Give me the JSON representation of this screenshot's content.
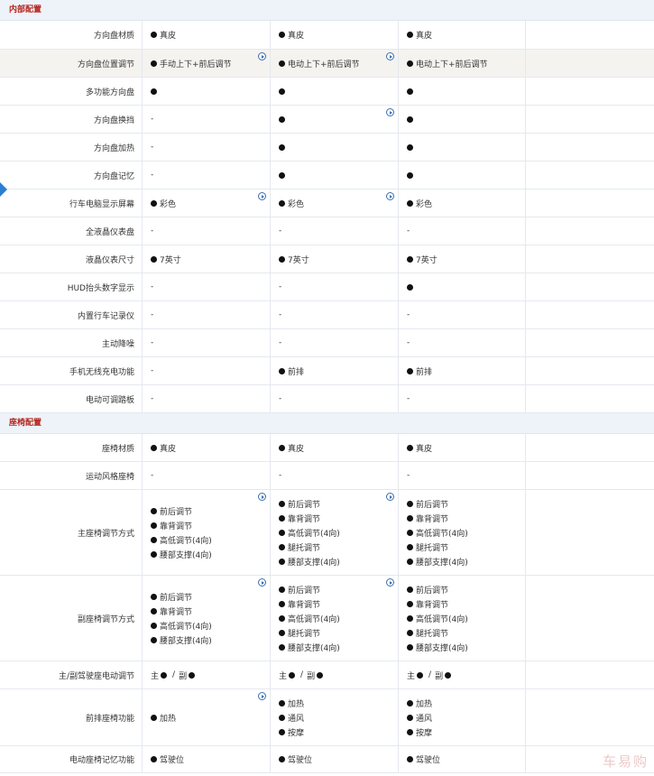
{
  "sections": [
    {
      "title": "内部配置",
      "rows": [
        {
          "label": "方向盘材质",
          "cells": [
            {
              "type": "lines",
              "lines": [
                {
                  "dot": true,
                  "text": "真皮"
                }
              ]
            },
            {
              "type": "lines",
              "lines": [
                {
                  "dot": true,
                  "text": "真皮"
                }
              ]
            },
            {
              "type": "lines",
              "lines": [
                {
                  "dot": true,
                  "text": "真皮"
                }
              ]
            }
          ],
          "h": 32
        },
        {
          "label": "方向盘位置调节",
          "hl": true,
          "cells": [
            {
              "type": "lines",
              "play": true,
              "lines": [
                {
                  "dot": true,
                  "text": "手动上下+前后调节"
                }
              ]
            },
            {
              "type": "lines",
              "play": true,
              "lines": [
                {
                  "dot": true,
                  "text": "电动上下+前后调节"
                }
              ]
            },
            {
              "type": "lines",
              "lines": [
                {
                  "dot": true,
                  "text": "电动上下+前后调节"
                }
              ]
            }
          ],
          "h": 31
        },
        {
          "label": "多功能方向盘",
          "cells": [
            {
              "type": "lines",
              "lines": [
                {
                  "dot": true,
                  "text": ""
                }
              ]
            },
            {
              "type": "lines",
              "lines": [
                {
                  "dot": true,
                  "text": ""
                }
              ]
            },
            {
              "type": "lines",
              "lines": [
                {
                  "dot": true,
                  "text": ""
                }
              ]
            }
          ],
          "h": 31
        },
        {
          "label": "方向盘换挡",
          "cells": [
            {
              "type": "lines",
              "lines": [
                {
                  "dot": false,
                  "text": "-"
                }
              ]
            },
            {
              "type": "lines",
              "play": true,
              "lines": [
                {
                  "dot": true,
                  "text": ""
                }
              ]
            },
            {
              "type": "lines",
              "lines": [
                {
                  "dot": true,
                  "text": ""
                }
              ]
            }
          ],
          "h": 31
        },
        {
          "label": "方向盘加热",
          "cells": [
            {
              "type": "lines",
              "lines": [
                {
                  "dot": false,
                  "text": "-"
                }
              ]
            },
            {
              "type": "lines",
              "lines": [
                {
                  "dot": true,
                  "text": ""
                }
              ]
            },
            {
              "type": "lines",
              "lines": [
                {
                  "dot": true,
                  "text": ""
                }
              ]
            }
          ],
          "h": 31
        },
        {
          "label": "方向盘记忆",
          "cells": [
            {
              "type": "lines",
              "lines": [
                {
                  "dot": false,
                  "text": "-"
                }
              ]
            },
            {
              "type": "lines",
              "lines": [
                {
                  "dot": true,
                  "text": ""
                }
              ]
            },
            {
              "type": "lines",
              "lines": [
                {
                  "dot": true,
                  "text": ""
                }
              ]
            }
          ],
          "h": 31
        },
        {
          "label": "行车电脑显示屏幕",
          "cells": [
            {
              "type": "lines",
              "play": true,
              "lines": [
                {
                  "dot": true,
                  "text": "彩色"
                }
              ]
            },
            {
              "type": "lines",
              "play": true,
              "lines": [
                {
                  "dot": true,
                  "text": "彩色"
                }
              ]
            },
            {
              "type": "lines",
              "lines": [
                {
                  "dot": true,
                  "text": "彩色"
                }
              ]
            }
          ],
          "h": 31
        },
        {
          "label": "全液晶仪表盘",
          "cells": [
            {
              "type": "lines",
              "lines": [
                {
                  "dot": false,
                  "text": "-"
                }
              ]
            },
            {
              "type": "lines",
              "lines": [
                {
                  "dot": false,
                  "text": "-"
                }
              ]
            },
            {
              "type": "lines",
              "lines": [
                {
                  "dot": false,
                  "text": "-"
                }
              ]
            }
          ],
          "h": 31
        },
        {
          "label": "液晶仪表尺寸",
          "cells": [
            {
              "type": "lines",
              "lines": [
                {
                  "dot": true,
                  "text": "7英寸"
                }
              ]
            },
            {
              "type": "lines",
              "lines": [
                {
                  "dot": true,
                  "text": "7英寸"
                }
              ]
            },
            {
              "type": "lines",
              "lines": [
                {
                  "dot": true,
                  "text": "7英寸"
                }
              ]
            }
          ],
          "h": 31
        },
        {
          "label": "HUD抬头数字显示",
          "cells": [
            {
              "type": "lines",
              "lines": [
                {
                  "dot": false,
                  "text": "-"
                }
              ]
            },
            {
              "type": "lines",
              "lines": [
                {
                  "dot": false,
                  "text": "-"
                }
              ]
            },
            {
              "type": "lines",
              "lines": [
                {
                  "dot": true,
                  "text": ""
                }
              ]
            }
          ],
          "h": 31
        },
        {
          "label": "内置行车记录仪",
          "cells": [
            {
              "type": "lines",
              "lines": [
                {
                  "dot": false,
                  "text": "-"
                }
              ]
            },
            {
              "type": "lines",
              "lines": [
                {
                  "dot": false,
                  "text": "-"
                }
              ]
            },
            {
              "type": "lines",
              "lines": [
                {
                  "dot": false,
                  "text": "-"
                }
              ]
            }
          ],
          "h": 31
        },
        {
          "label": "主动降噪",
          "cells": [
            {
              "type": "lines",
              "lines": [
                {
                  "dot": false,
                  "text": "-"
                }
              ]
            },
            {
              "type": "lines",
              "lines": [
                {
                  "dot": false,
                  "text": "-"
                }
              ]
            },
            {
              "type": "lines",
              "lines": [
                {
                  "dot": false,
                  "text": "-"
                }
              ]
            }
          ],
          "h": 31
        },
        {
          "label": "手机无线充电功能",
          "cells": [
            {
              "type": "lines",
              "lines": [
                {
                  "dot": false,
                  "text": "-"
                }
              ]
            },
            {
              "type": "lines",
              "lines": [
                {
                  "dot": true,
                  "text": "前排"
                }
              ]
            },
            {
              "type": "lines",
              "lines": [
                {
                  "dot": true,
                  "text": "前排"
                }
              ]
            }
          ],
          "h": 31
        },
        {
          "label": "电动可调踏板",
          "cells": [
            {
              "type": "lines",
              "lines": [
                {
                  "dot": false,
                  "text": "-"
                }
              ]
            },
            {
              "type": "lines",
              "lines": [
                {
                  "dot": false,
                  "text": "-"
                }
              ]
            },
            {
              "type": "lines",
              "lines": [
                {
                  "dot": false,
                  "text": "-"
                }
              ]
            }
          ],
          "h": 31
        }
      ]
    },
    {
      "title": "座椅配置",
      "rows": [
        {
          "label": "座椅材质",
          "cells": [
            {
              "type": "lines",
              "lines": [
                {
                  "dot": true,
                  "text": "真皮"
                }
              ]
            },
            {
              "type": "lines",
              "lines": [
                {
                  "dot": true,
                  "text": "真皮"
                }
              ]
            },
            {
              "type": "lines",
              "lines": [
                {
                  "dot": true,
                  "text": "真皮"
                }
              ]
            }
          ],
          "h": 31
        },
        {
          "label": "运动风格座椅",
          "cells": [
            {
              "type": "lines",
              "lines": [
                {
                  "dot": false,
                  "text": "-"
                }
              ]
            },
            {
              "type": "lines",
              "lines": [
                {
                  "dot": false,
                  "text": "-"
                }
              ]
            },
            {
              "type": "lines",
              "lines": [
                {
                  "dot": false,
                  "text": "-"
                }
              ]
            }
          ],
          "h": 31
        },
        {
          "label": "主座椅调节方式",
          "cells": [
            {
              "type": "lines",
              "play": true,
              "lines": [
                {
                  "dot": true,
                  "text": "前后调节"
                },
                {
                  "dot": true,
                  "text": "靠背调节"
                },
                {
                  "dot": true,
                  "text": "高低调节(4向)"
                },
                {
                  "dot": true,
                  "text": "腰部支撑(4向)"
                }
              ]
            },
            {
              "type": "lines",
              "play": true,
              "lines": [
                {
                  "dot": true,
                  "text": "前后调节"
                },
                {
                  "dot": true,
                  "text": "靠背调节"
                },
                {
                  "dot": true,
                  "text": "高低调节(4向)"
                },
                {
                  "dot": true,
                  "text": "腿托调节"
                },
                {
                  "dot": true,
                  "text": "腰部支撑(4向)"
                }
              ]
            },
            {
              "type": "lines",
              "lines": [
                {
                  "dot": true,
                  "text": "前后调节"
                },
                {
                  "dot": true,
                  "text": "靠背调节"
                },
                {
                  "dot": true,
                  "text": "高低调节(4向)"
                },
                {
                  "dot": true,
                  "text": "腿托调节"
                },
                {
                  "dot": true,
                  "text": "腰部支撑(4向)"
                }
              ]
            }
          ],
          "h": 95
        },
        {
          "label": "副座椅调节方式",
          "cells": [
            {
              "type": "lines",
              "play": true,
              "lines": [
                {
                  "dot": true,
                  "text": "前后调节"
                },
                {
                  "dot": true,
                  "text": "靠背调节"
                },
                {
                  "dot": true,
                  "text": "高低调节(4向)"
                },
                {
                  "dot": true,
                  "text": "腰部支撑(4向)"
                }
              ]
            },
            {
              "type": "lines",
              "play": true,
              "lines": [
                {
                  "dot": true,
                  "text": "前后调节"
                },
                {
                  "dot": true,
                  "text": "靠背调节"
                },
                {
                  "dot": true,
                  "text": "高低调节(4向)"
                },
                {
                  "dot": true,
                  "text": "腿托调节"
                },
                {
                  "dot": true,
                  "text": "腰部支撑(4向)"
                }
              ]
            },
            {
              "type": "lines",
              "lines": [
                {
                  "dot": true,
                  "text": "前后调节"
                },
                {
                  "dot": true,
                  "text": "靠背调节"
                },
                {
                  "dot": true,
                  "text": "高低调节(4向)"
                },
                {
                  "dot": true,
                  "text": "腿托调节"
                },
                {
                  "dot": true,
                  "text": "腰部支撑(4向)"
                }
              ]
            }
          ],
          "h": 95
        },
        {
          "label": "主/副驾驶座电动调节",
          "cells": [
            {
              "type": "pair",
              "a": "主",
              "sep": "/",
              "b": "副"
            },
            {
              "type": "pair",
              "a": "主",
              "sep": "/",
              "b": "副"
            },
            {
              "type": "pair",
              "a": "主",
              "sep": "/",
              "b": "副"
            }
          ],
          "h": 31
        },
        {
          "label": "前排座椅功能",
          "cells": [
            {
              "type": "lines",
              "play": true,
              "lines": [
                {
                  "dot": true,
                  "text": "加热"
                }
              ]
            },
            {
              "type": "lines",
              "lines": [
                {
                  "dot": true,
                  "text": "加热"
                },
                {
                  "dot": true,
                  "text": "通风"
                },
                {
                  "dot": true,
                  "text": "按摩"
                }
              ]
            },
            {
              "type": "lines",
              "lines": [
                {
                  "dot": true,
                  "text": "加热"
                },
                {
                  "dot": true,
                  "text": "通风"
                },
                {
                  "dot": true,
                  "text": "按摩"
                }
              ]
            }
          ],
          "h": 63
        },
        {
          "label": "电动座椅记忆功能",
          "cells": [
            {
              "type": "lines",
              "lines": [
                {
                  "dot": true,
                  "text": "驾驶位"
                }
              ]
            },
            {
              "type": "lines",
              "lines": [
                {
                  "dot": true,
                  "text": "驾驶位"
                }
              ]
            },
            {
              "type": "lines",
              "lines": [
                {
                  "dot": true,
                  "text": "驾驶位"
                }
              ]
            }
          ],
          "h": 30
        }
      ]
    }
  ],
  "watermark": "车易购",
  "colors": {
    "section_title": "#b3261e",
    "section_bg": "#eef3f9",
    "play_icon": "#3a6fb0",
    "left_arrow": "#2b7fd0"
  }
}
